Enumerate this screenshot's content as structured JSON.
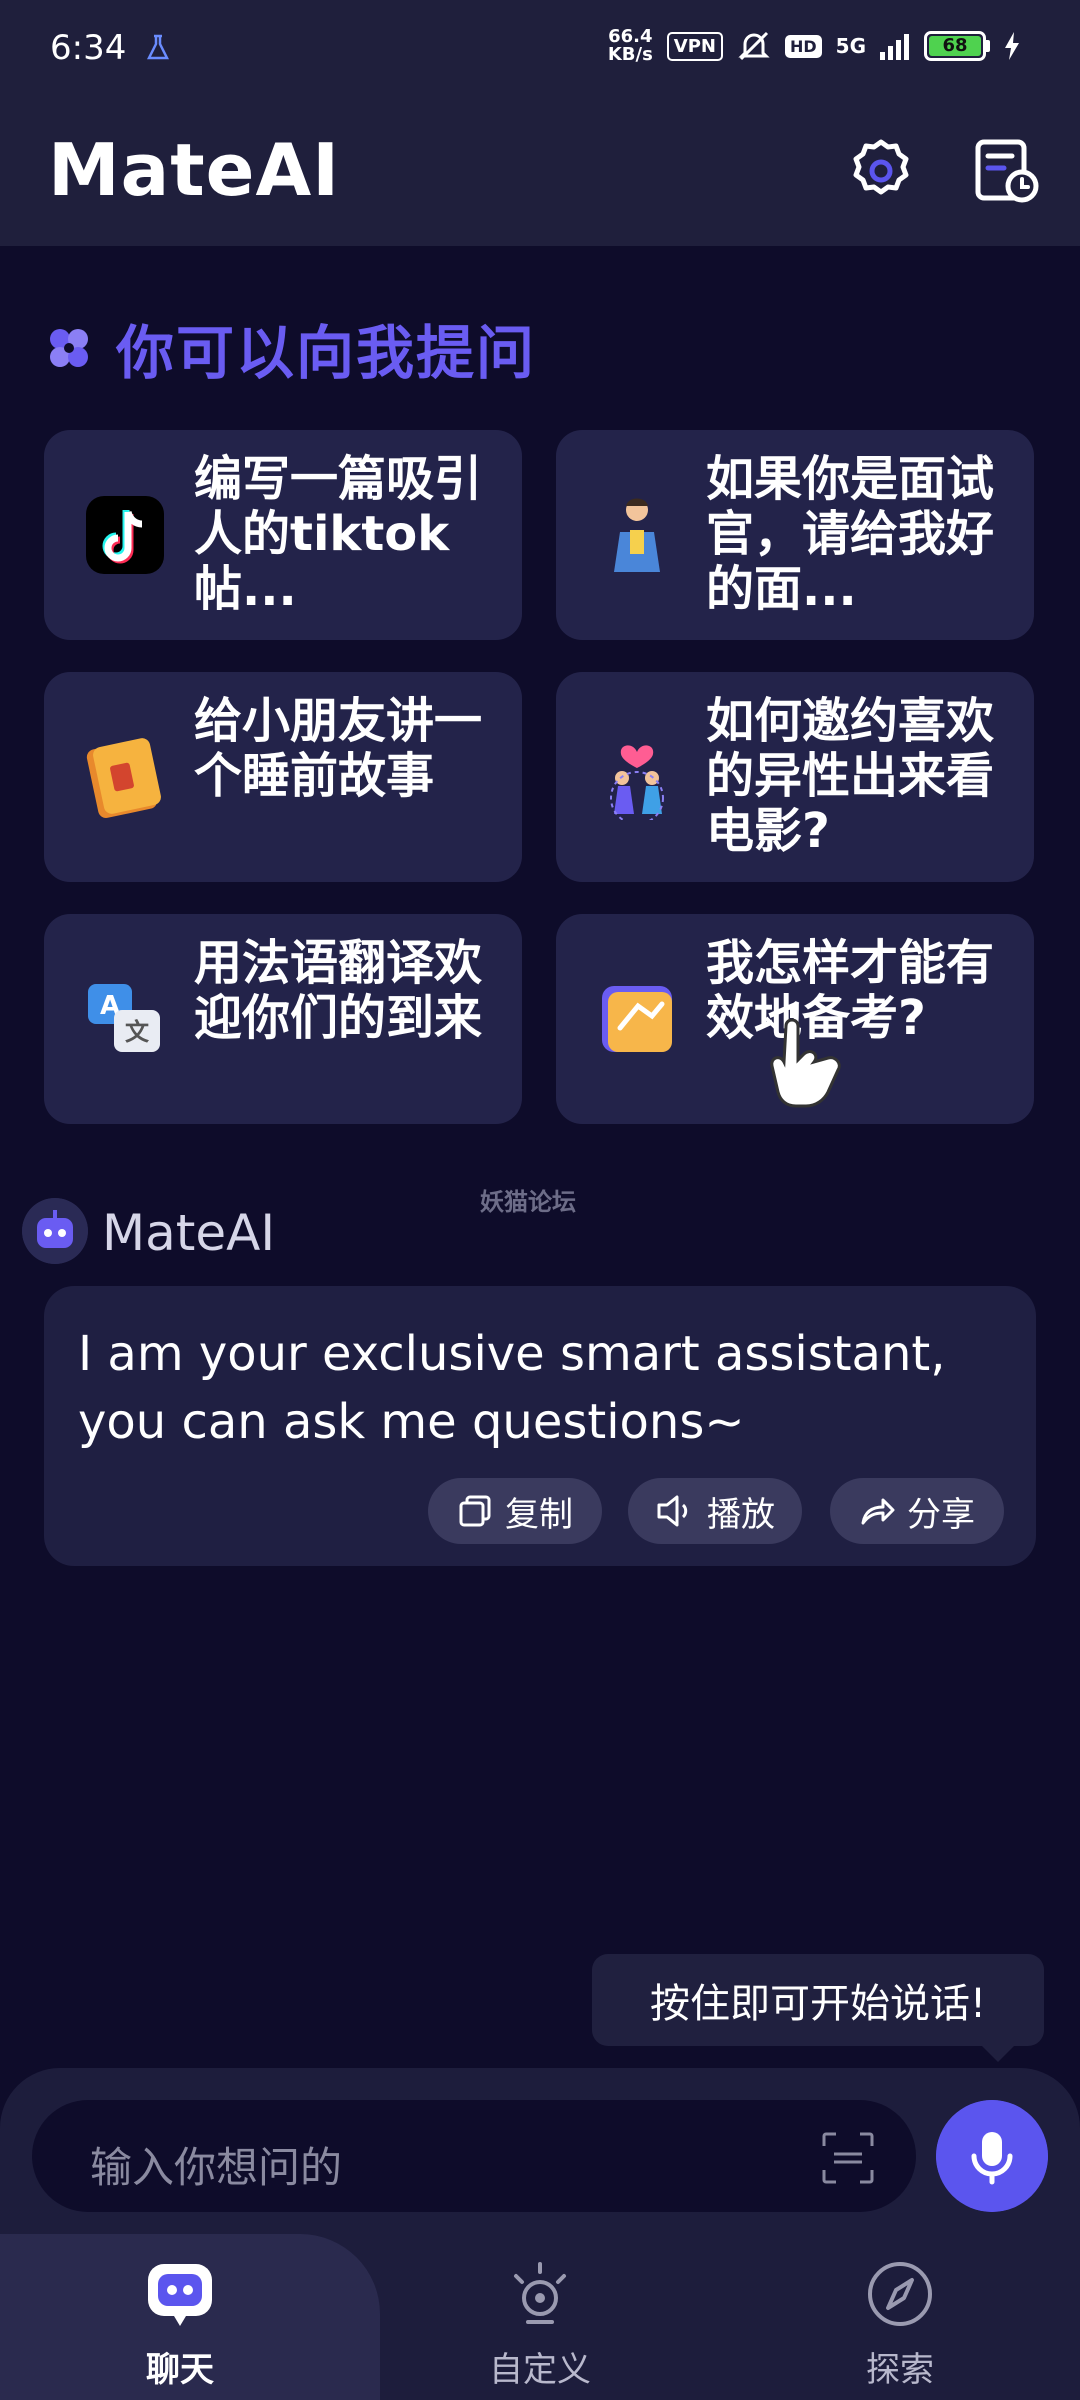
{
  "status_bar": {
    "time": "6:34",
    "network_speed_value": "66.4",
    "network_speed_unit": "KB/s",
    "vpn": "VPN",
    "hd": "HD",
    "signal": "5G",
    "battery": "68"
  },
  "header": {
    "title": "MateAI"
  },
  "suggestions": {
    "heading": "你可以向我提问",
    "items": [
      {
        "text": "编写一篇吸引人的tiktok帖...",
        "icon": "tiktok-icon"
      },
      {
        "text": "如果你是面试官，请给我好的面...",
        "icon": "interviewer-icon"
      },
      {
        "text": "给小朋友讲一个睡前故事",
        "icon": "storybook-icon"
      },
      {
        "text": "如何邀约喜欢的异性出来看电影?",
        "icon": "dating-icon"
      },
      {
        "text": "用法语翻译欢迎你们的到来",
        "icon": "translate-icon"
      },
      {
        "text": "我怎样才能有效地备考?",
        "icon": "study-icon"
      }
    ]
  },
  "watermark": "妖猫论坛",
  "bot_message": {
    "name": "MateAI",
    "text": "I am your exclusive smart assistant, you can ask me questions~",
    "actions": {
      "copy": "复制",
      "play": "播放",
      "share": "分享"
    }
  },
  "tooltip": "按住即可开始说话!",
  "input": {
    "placeholder": "输入你想问的"
  },
  "nav": {
    "chat": "聊天",
    "custom": "自定义",
    "explore": "探索"
  },
  "colors": {
    "accent": "#5b55ee",
    "background": "#0e0c2a",
    "card": "#23234a"
  }
}
